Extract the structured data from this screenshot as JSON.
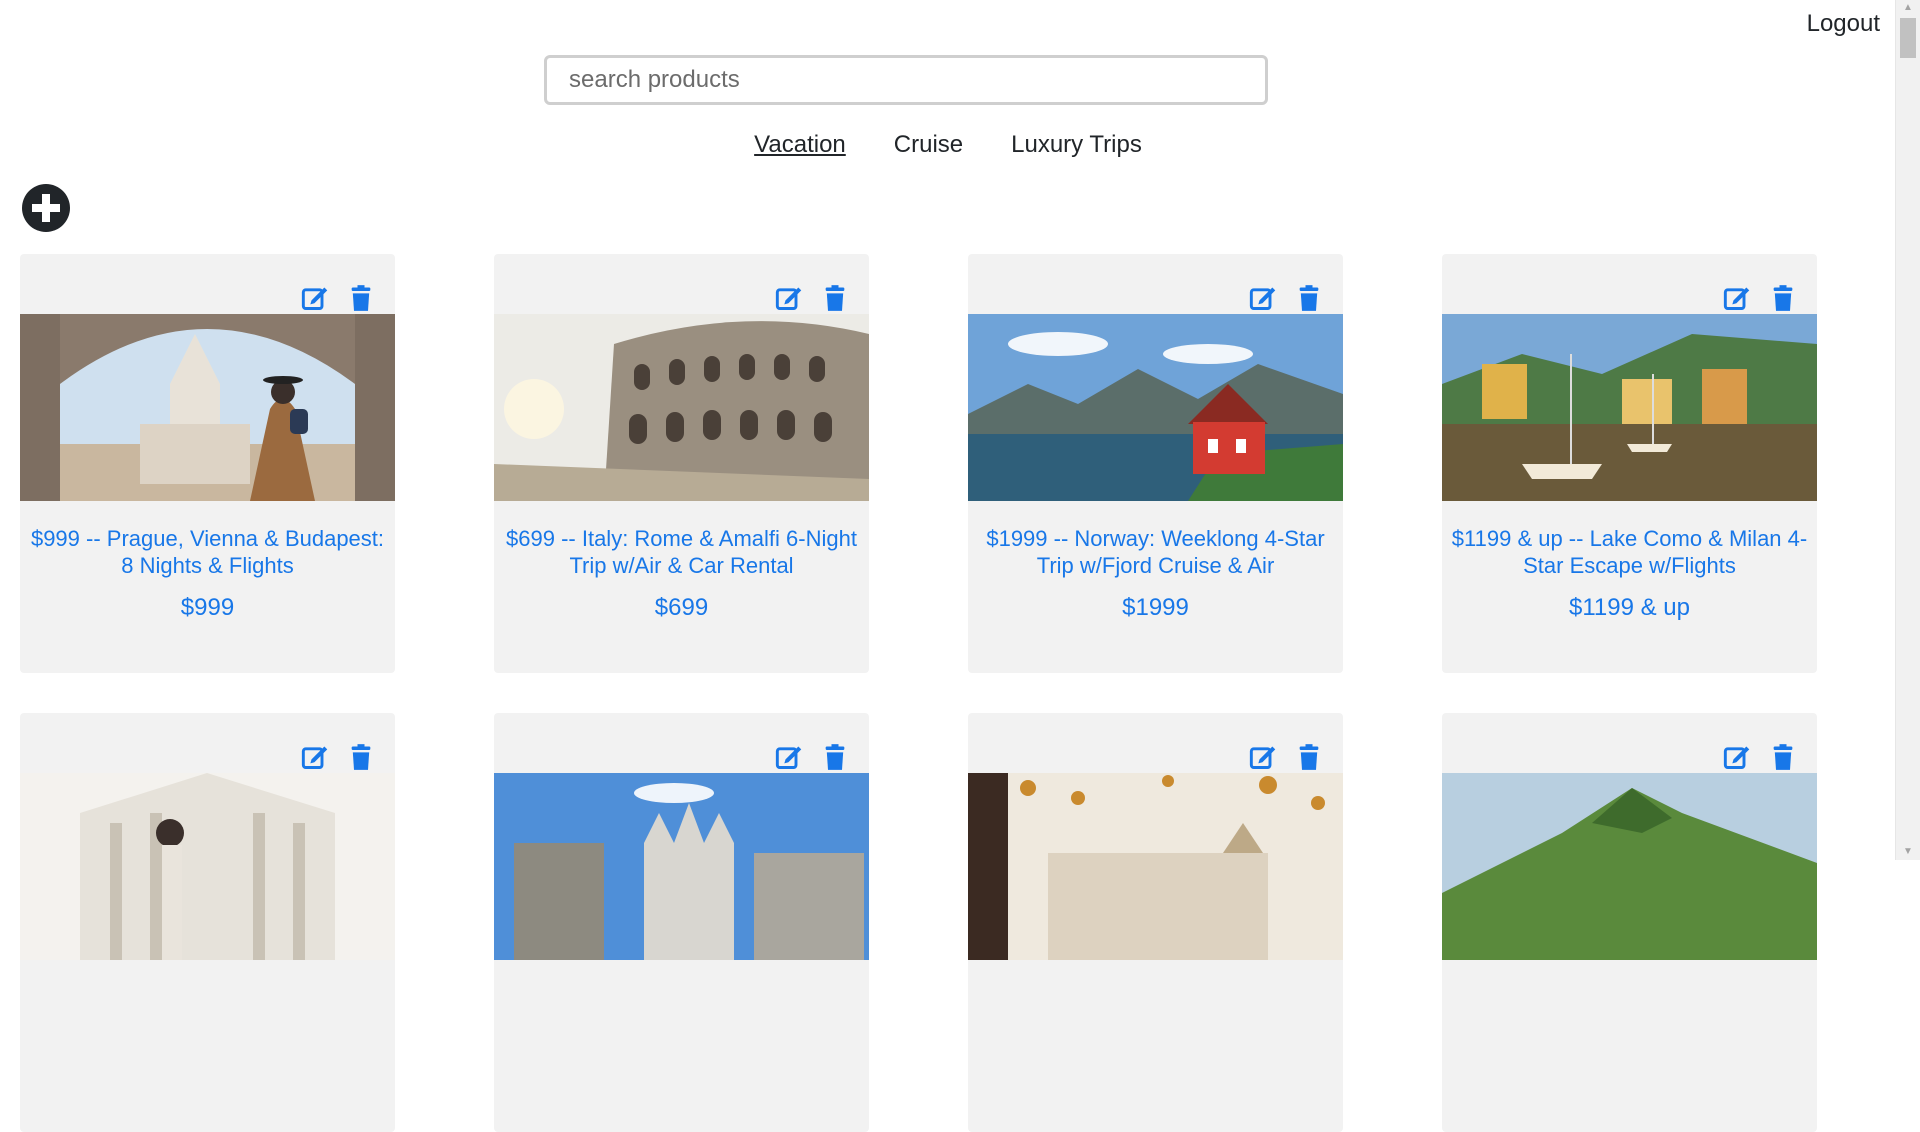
{
  "header": {
    "logout_label": "Logout"
  },
  "search": {
    "placeholder": "search products",
    "value": ""
  },
  "tabs": [
    {
      "label": "Vacation",
      "active": true
    },
    {
      "label": "Cruise",
      "active": false
    },
    {
      "label": "Luxury Trips",
      "active": false
    }
  ],
  "toolbar": {
    "add_icon": "plus-circle-icon"
  },
  "card_icons": {
    "edit": "edit-icon",
    "delete": "trash-icon"
  },
  "colors": {
    "accent": "#1877e8",
    "card_bg": "#f2f2f2",
    "text": "#212529"
  },
  "products": [
    {
      "title": "$999 -- Prague, Vienna & Budapest: 8 Nights & Flights",
      "price": "$999",
      "image_icon": "prague-castle-photo"
    },
    {
      "title": "$699 -- Italy: Rome & Amalfi 6-Night Trip w/Air & Car Rental",
      "price": "$699",
      "image_icon": "colosseum-photo"
    },
    {
      "title": "$1999 -- Norway: Weeklong 4-Star Trip w/Fjord Cruise & Air",
      "price": "$1999",
      "image_icon": "fjord-red-house-photo"
    },
    {
      "title": "$1199 & up -- Lake Como & Milan 4-Star Escape w/Flights",
      "price": "$1199 & up",
      "image_icon": "lake-como-harbor-photo"
    },
    {
      "title": "",
      "price": "",
      "image_icon": "florence-cathedral-photo"
    },
    {
      "title": "",
      "price": "",
      "image_icon": "milan-duomo-photo"
    },
    {
      "title": "",
      "price": "",
      "image_icon": "autumn-palace-photo"
    },
    {
      "title": "",
      "price": "",
      "image_icon": "green-mountain-photo"
    }
  ]
}
